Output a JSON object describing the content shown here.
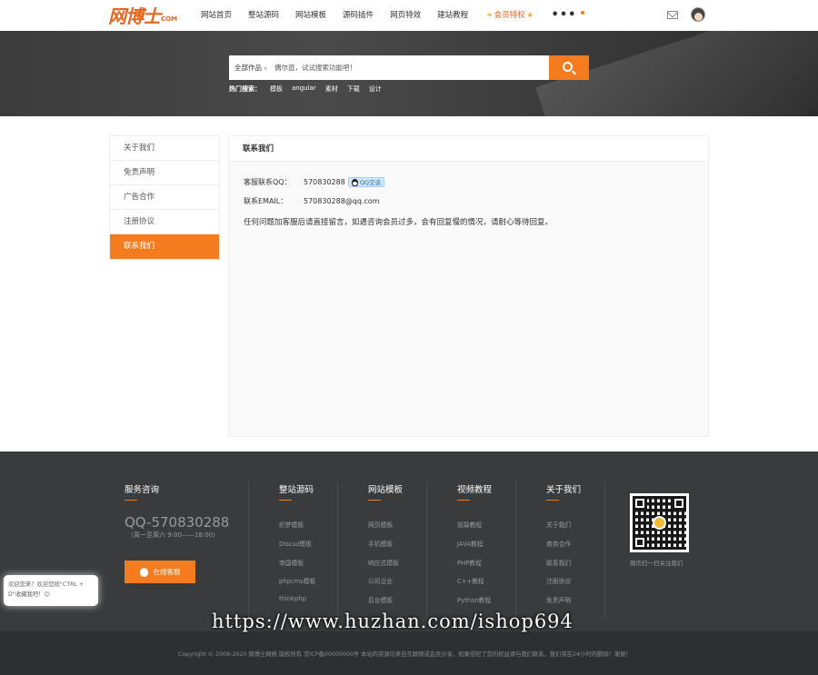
{
  "header": {
    "logo_main": "网博士",
    "logo_domain": "COM",
    "nav": [
      "网站首页",
      "整站源码",
      "网站模板",
      "源码插件",
      "网页特效",
      "建站教程"
    ],
    "vip_label": "会员特权",
    "more_label": "•••"
  },
  "search": {
    "category": "全部作品",
    "placeholder": "偶尔逛，试试搜索功能吧！",
    "hot_label": "热门搜索：",
    "hot_terms": [
      "模板",
      "angular",
      "素材",
      "下载",
      "设计"
    ]
  },
  "sidebar": {
    "items": [
      "关于我们",
      "免责声明",
      "广告合作",
      "注册协议",
      "联系我们"
    ],
    "active_index": 4
  },
  "main": {
    "title": "联系我们",
    "qq_label": "客服联系QQ：",
    "qq_value": "570830288",
    "qq_badge": "QQ交谈",
    "email_label": "联系EMAIL：",
    "email_value": "570830288@qq.com",
    "notice": "任何问题加客服后请直接留言，如遇咨询会员过多，会有回复慢的情况，请耐心等待回复。"
  },
  "footer": {
    "service_title": "服务咨询",
    "qq_number": "QQ-570830288",
    "hours": "（周一至周六 9:00——18:00）",
    "service_button": "在线客服",
    "columns": [
      {
        "title": "整站源码",
        "links": [
          "织梦模板",
          "Discuz模板",
          "帝国模板",
          "phpcms模板",
          "thinkphp"
        ]
      },
      {
        "title": "网站模板",
        "links": [
          "网页模板",
          "手机模板",
          "响应式模板",
          "公司企业",
          "后台模板"
        ]
      },
      {
        "title": "视频教程",
        "links": [
          "前端教程",
          "JAVA教程",
          "PHP教程",
          "C++教程",
          "Python教程"
        ]
      },
      {
        "title": "关于我们",
        "links": [
          "关于我们",
          "商务合作",
          "联系我们",
          "注册协议",
          "免责声明"
        ]
      }
    ],
    "qr_caption": "微信扫一扫关注我们",
    "copyright": "Copyright © 2008-2020 网博士网络 版权所有 京ICP备00000000号 本站的资源均来自互联网或会员分享，如果侵犯了您的权益请与我们联系，我们将在24小时内删除！谢谢！"
  },
  "watermark": "https://www.huzhan.com/ishop694",
  "float_tip": "欢迎您来？欢迎您按“CTRL + D”收藏我吧！☺",
  "colors": {
    "accent": "#f57b1f",
    "footer_bg": "#3a3b3d",
    "footer_bottom_bg": "#2e2f31"
  }
}
